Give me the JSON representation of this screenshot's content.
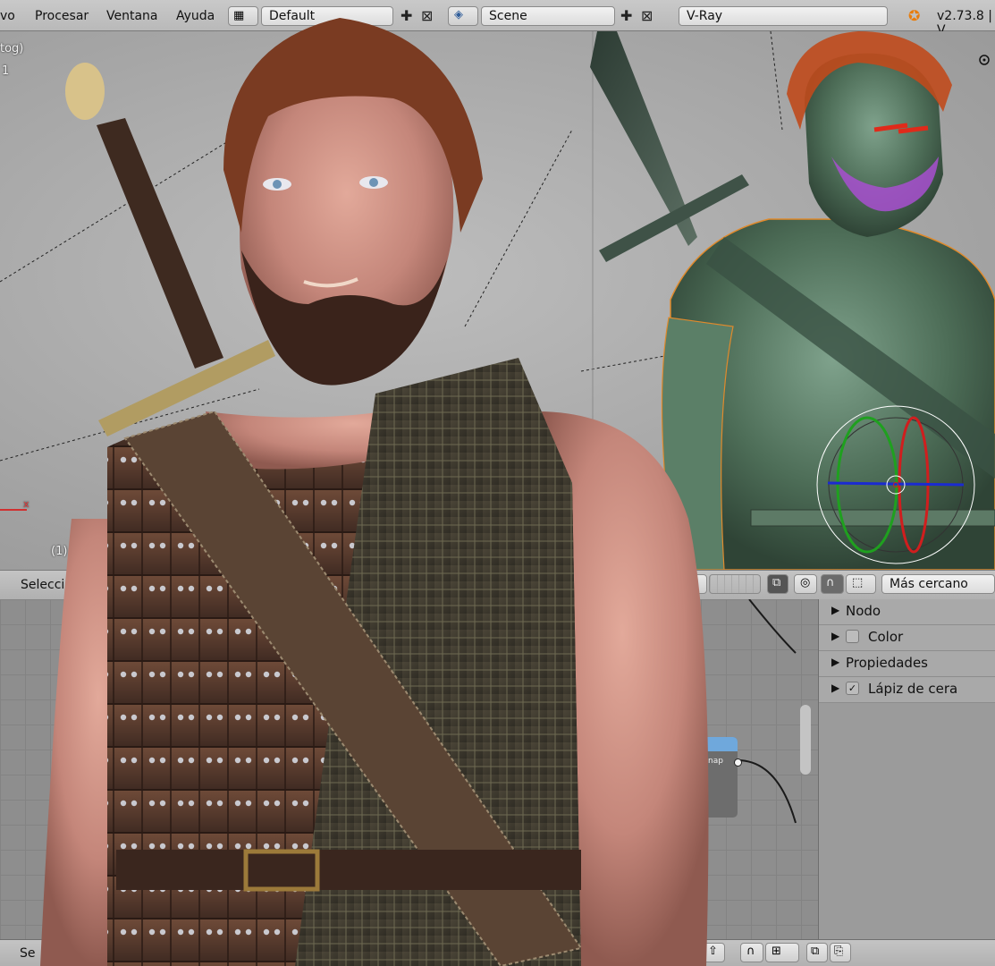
{
  "top_menu": {
    "file_partial": "vo",
    "items": [
      "Procesar",
      "Ventana",
      "Ayuda"
    ],
    "layout": "Default",
    "scene": "Scene",
    "engine": "V-Ray",
    "version": "v2.73.8 | V"
  },
  "viewport": {
    "view_label_partial": "tog)",
    "layer_partial": "1",
    "object_info_partial": "(1) C",
    "axis_x": "x"
  },
  "viewport_header": {
    "select_partial": "Selecciona",
    "snap_target": "Más cercano"
  },
  "n_panel": {
    "rows": [
      {
        "label": "Nodo",
        "has_checkbox": false,
        "checked": false
      },
      {
        "label": "Color",
        "has_checkbox": true,
        "checked": false
      },
      {
        "label": "Propiedades",
        "has_checkbox": false,
        "checked": false
      },
      {
        "label": "Lápiz de cera",
        "has_checkbox": true,
        "checked": true
      }
    ]
  },
  "node": {
    "socket_label_partial": "nap"
  },
  "bottom_header": {
    "select_partial": "Se"
  }
}
